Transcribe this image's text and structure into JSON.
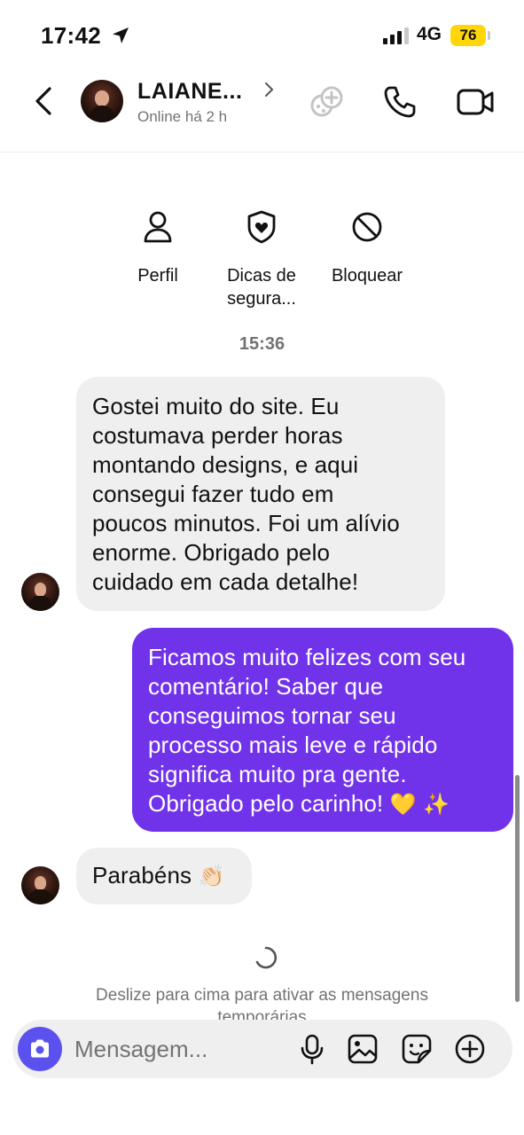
{
  "status_bar": {
    "time": "17:42",
    "network": "4G",
    "battery": "76",
    "battery_color": "#ffd60a"
  },
  "header": {
    "name": "LAIANE...",
    "presence": "Online há 2 h",
    "icons": [
      "back-icon",
      "game-icon",
      "phone-icon",
      "video-icon"
    ]
  },
  "profile_actions": [
    {
      "label": "Perfil",
      "icon": "person-icon"
    },
    {
      "label_line1": "Dicas de",
      "label_line2": "segura...",
      "icon": "shield-icon"
    },
    {
      "label": "Bloquear",
      "icon": "block-icon"
    }
  ],
  "timestamp": "15:36",
  "messages": [
    {
      "direction": "incoming",
      "lines": [
        "Gostei muito do site. Eu",
        "costumava perder horas",
        "montando designs, e aqui",
        "consegui fazer tudo em",
        "poucos minutos. Foi um alívio",
        "enorme. Obrigado pelo",
        "cuidado em cada detalhe!"
      ]
    },
    {
      "direction": "outgoing",
      "lines": [
        "Ficamos muito felizes com seu",
        "comentário! Saber que",
        "conseguimos tornar seu",
        "processo mais leve e rápido",
        "significa muito pra gente."
      ],
      "last_line_text": "Obrigado pelo carinho! ",
      "last_line_emoji": "💛 ✨"
    },
    {
      "direction": "incoming",
      "text": "Parabéns ",
      "emoji": "👏🏻"
    }
  ],
  "hint": {
    "line1": "Deslize para cima para ativar as mensagens",
    "line2": "temporárias"
  },
  "composer": {
    "placeholder": "Mensagem...",
    "accent": "#5b51ef",
    "icons": [
      "camera-icon",
      "microphone-icon",
      "gallery-icon",
      "sticker-icon",
      "plus-icon"
    ]
  },
  "colors": {
    "outgoing_bubble": "#7133ea",
    "incoming_bubble": "#efefef"
  }
}
